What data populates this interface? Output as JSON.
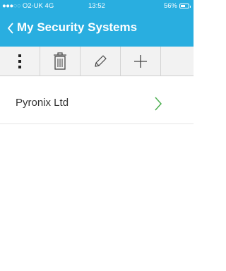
{
  "status_bar": {
    "signal_dots_filled": "●●●",
    "signal_dots_empty": "○○",
    "carrier": "O2-UK",
    "network": "4G",
    "time": "13:52",
    "battery_percent": "56%",
    "battery_level": 0.56
  },
  "nav": {
    "back_glyph": "<",
    "title": "My Security Systems"
  },
  "toolbar": {
    "icons": [
      "more-vertical-icon",
      "trash-icon",
      "pencil-icon",
      "plus-icon"
    ]
  },
  "systems": [
    {
      "name": "Pyronix Ltd",
      "chevron": "chevron-right-icon"
    }
  ],
  "colors": {
    "header": "#29aee0",
    "toolbar_bg": "#f2f2f2",
    "chevron": "#4caf50",
    "text": "#333333"
  }
}
